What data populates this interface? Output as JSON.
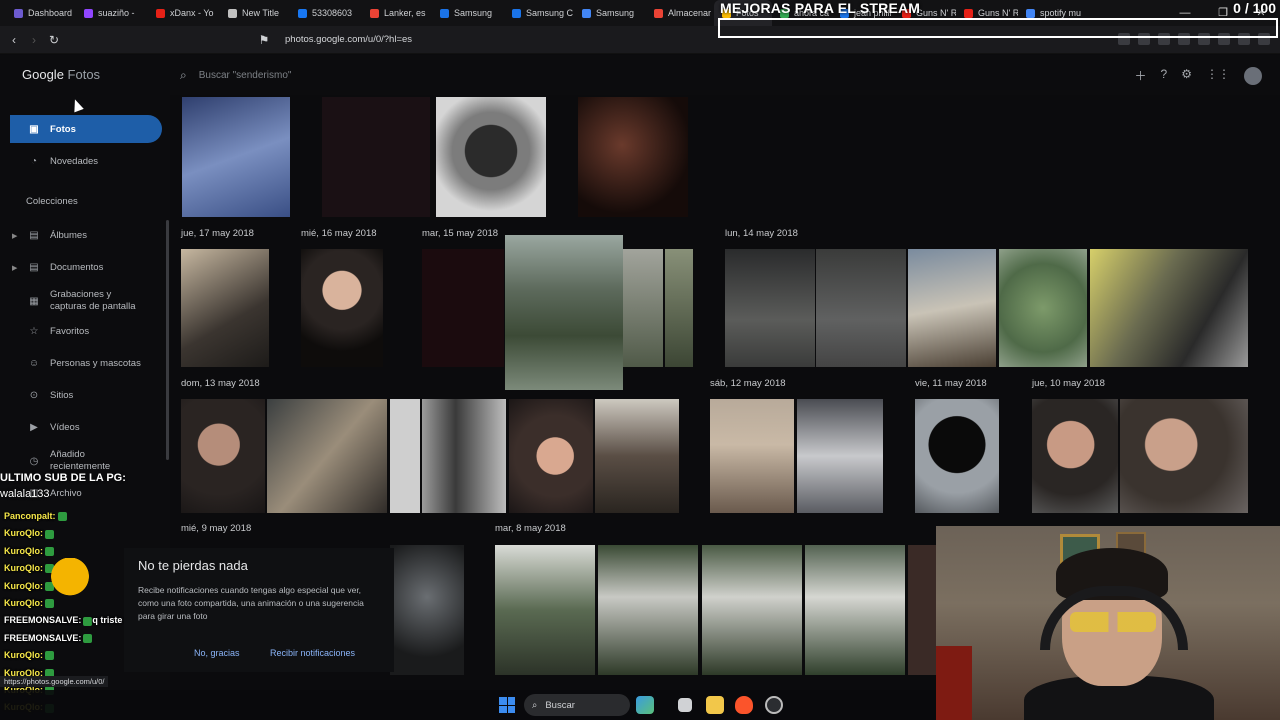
{
  "stream_overlay": {
    "title": "MEJORAS PARA EL STREAM",
    "counter": "0 / 100",
    "sub_note_line1": "ULTIMO SUB DE LA PG:",
    "sub_note_line2": "walala133"
  },
  "browser": {
    "tabs": [
      {
        "label": "Dashboard",
        "color": "#6d5bd0"
      },
      {
        "label": "suaziño -",
        "color": "#9146ff"
      },
      {
        "label": "xDanx - Yo",
        "color": "#e62117"
      },
      {
        "label": "New Title",
        "color": "#c0c0c0"
      },
      {
        "label": "53308603",
        "color": "#1877f2"
      },
      {
        "label": "Lanker, es",
        "color": "#ea4335"
      },
      {
        "label": "Samsung",
        "color": "#1a73e8"
      },
      {
        "label": "Samsung C",
        "color": "#1a73e8"
      },
      {
        "label": "Samsung",
        "color": "#4285f4"
      },
      {
        "label": "Almacenar",
        "color": "#ea4335"
      },
      {
        "label": "Fotos",
        "color": "#fbbc04"
      },
      {
        "label": "ahora ca",
        "color": "#34a853"
      },
      {
        "label": "jean philli",
        "color": "#1a73e8"
      },
      {
        "label": "Guns N' Ro",
        "color": "#e62117"
      },
      {
        "label": "Guns N' R",
        "color": "#e62117"
      },
      {
        "label": "spotify mu",
        "color": "#4285f4"
      }
    ],
    "active_tab_index": 10,
    "url": "photos.google.com/u/0/?hl=es",
    "window_controls": [
      "—",
      "❐",
      "✕"
    ],
    "status_url": "https://photos.google.com/u/0/"
  },
  "header": {
    "logo_google": "Google",
    "logo_product": "Fotos",
    "search_placeholder": "Buscar \"senderismo\""
  },
  "sidebar": {
    "items": [
      {
        "label": "Fotos",
        "icon": "photo-icon",
        "glyph": "▣",
        "active": true
      },
      {
        "label": "Novedades",
        "icon": "bell-icon",
        "glyph": "🔔",
        "active": false
      }
    ],
    "collections_title": "Colecciones",
    "collections": [
      {
        "label": "Álbumes",
        "icon": "album-icon",
        "glyph": "▤",
        "caret": true
      },
      {
        "label": "Documentos",
        "icon": "document-icon",
        "glyph": "▤",
        "caret": true
      },
      {
        "label": "Grabaciones y capturas de pantalla",
        "icon": "screenshot-icon",
        "glyph": "▦",
        "caret": false
      },
      {
        "label": "Favoritos",
        "icon": "star-icon",
        "glyph": "☆",
        "caret": false
      },
      {
        "label": "Personas y mascotas",
        "icon": "face-icon",
        "glyph": "☺",
        "caret": false
      },
      {
        "label": "Sitios",
        "icon": "pin-icon",
        "glyph": "⊙",
        "caret": false
      },
      {
        "label": "Vídeos",
        "icon": "video-icon",
        "glyph": "▶",
        "caret": false
      },
      {
        "label": "Añadido recientemente",
        "icon": "recent-icon",
        "glyph": "◷",
        "caret": false
      },
      {
        "label": "Archivo",
        "icon": "archive-icon",
        "glyph": "▥",
        "caret": false
      }
    ]
  },
  "dates": [
    "jue, 17 may 2018",
    "mié, 16 may 2018",
    "mar, 15 may 2018",
    "lun, 14 may 2018",
    "dom, 13 may 2018",
    "sáb, 12 may 2018",
    "vie, 11 may 2018",
    "jue, 10 may 2018",
    "mié, 9 may 2018",
    "mar, 8 may 2018"
  ],
  "notification": {
    "title": "No te pierdas nada",
    "body": "Recibe notificaciones cuando tengas algo especial que ver, como una foto compartida, una animación o una sugerencia para girar una foto",
    "dismiss": "No, gracias",
    "accept": "Recibir notificaciones"
  },
  "chat": [
    {
      "user": "Panconpalt:",
      "msg": "",
      "color": "#f7e84a"
    },
    {
      "user": "KuroQlo:",
      "msg": "",
      "color": "#f7e84a"
    },
    {
      "user": "KuroQlo:",
      "msg": "",
      "color": "#f7e84a"
    },
    {
      "user": "KuroQlo:",
      "msg": "",
      "color": "#f7e84a"
    },
    {
      "user": "KuroQlo:",
      "msg": "",
      "color": "#f7e84a"
    },
    {
      "user": "KuroQlo:",
      "msg": "",
      "color": "#f7e84a"
    },
    {
      "user": "FREEMONSALVE:",
      "msg": "q triste como pasa el tiempo ki",
      "color": "#ffffff"
    },
    {
      "user": "FREEMONSALVE:",
      "msg": "",
      "color": "#ffffff"
    },
    {
      "user": "KuroQlo:",
      "msg": "",
      "color": "#f7e84a"
    },
    {
      "user": "KuroQlo:",
      "msg": "",
      "color": "#f7e84a"
    },
    {
      "user": "KuroQlo:",
      "msg": "",
      "color": "#f7e84a"
    },
    {
      "user": "KuroQlo:",
      "msg": "",
      "color": "#f7e84a"
    }
  ],
  "taskbar": {
    "search_label": "Buscar"
  }
}
